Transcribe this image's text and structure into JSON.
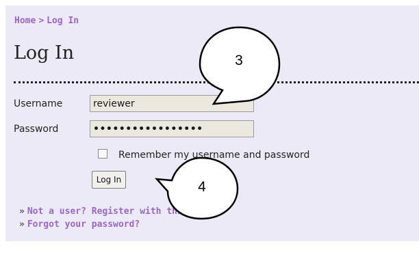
{
  "breadcrumb": {
    "home": "Home",
    "separator": ">",
    "current": "Log In"
  },
  "page_title": "Log In",
  "form": {
    "username_label": "Username",
    "username_value": "reviewer",
    "password_label": "Password",
    "password_value": "•••••••••••••••••",
    "remember_label": "Remember my username and password",
    "remember_checked": false,
    "submit_label": "Log In"
  },
  "links": [
    {
      "bullet": "»",
      "label": "Not a user? Register with this site"
    },
    {
      "bullet": "»",
      "label": "Forgot your password?"
    }
  ],
  "callouts": [
    {
      "number": "3"
    },
    {
      "number": "4"
    }
  ],
  "colors": {
    "link": "#9966cc",
    "panel_background": "#eceaf6",
    "input_background": "#ebe9dd"
  }
}
